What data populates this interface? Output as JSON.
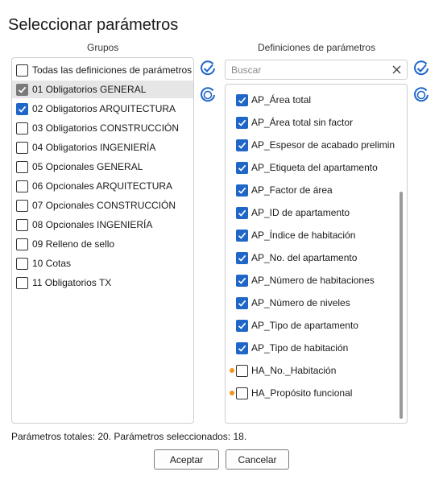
{
  "dialog": {
    "title": "Seleccionar parámetros",
    "groups_header": "Grupos",
    "definitions_header": "Definiciones de parámetros",
    "search_placeholder": "Buscar",
    "status": "Parámetros totales: 20. Parámetros seleccionados: 18.",
    "accept_label": "Aceptar",
    "cancel_label": "Cancelar",
    "accent_color": "#1e66c8",
    "highlight_dot_color": "#f0961e"
  },
  "groups": [
    {
      "label": "Todas las definiciones de parámetros",
      "state": "unchecked",
      "selected": false
    },
    {
      "label": "01 Obligatorios GENERAL",
      "state": "checked-gray",
      "selected": true
    },
    {
      "label": "02 Obligatorios ARQUITECTURA",
      "state": "checked",
      "selected": false
    },
    {
      "label": "03 Obligatorios CONSTRUCCIÓN",
      "state": "unchecked",
      "selected": false
    },
    {
      "label": "04 Obligatorios INGENIERÍA",
      "state": "unchecked",
      "selected": false
    },
    {
      "label": "05 Opcionales GENERAL",
      "state": "unchecked",
      "selected": false
    },
    {
      "label": "06 Opcionales ARQUITECTURA",
      "state": "unchecked",
      "selected": false
    },
    {
      "label": "07 Opcionales CONSTRUCCIÓN",
      "state": "unchecked",
      "selected": false
    },
    {
      "label": "08 Opcionales INGENIERÍA",
      "state": "unchecked",
      "selected": false
    },
    {
      "label": "09 Relleno de sello",
      "state": "unchecked",
      "selected": false
    },
    {
      "label": "10 Cotas",
      "state": "unchecked",
      "selected": false
    },
    {
      "label": "11 Obligatorios TX",
      "state": "unchecked",
      "selected": false
    }
  ],
  "definitions": [
    {
      "label": "AP_Área total",
      "checked": true,
      "dot": false
    },
    {
      "label": "AP_Área total sin factor",
      "checked": true,
      "dot": false
    },
    {
      "label": "AP_Espesor de acabado prelimin",
      "checked": true,
      "dot": false
    },
    {
      "label": "AP_Etiqueta del apartamento",
      "checked": true,
      "dot": false
    },
    {
      "label": "AP_Factor de área",
      "checked": true,
      "dot": false
    },
    {
      "label": "AP_ID de apartamento",
      "checked": true,
      "dot": false
    },
    {
      "label": "AP_Índice de habitación",
      "checked": true,
      "dot": false
    },
    {
      "label": "AP_No. del apartamento",
      "checked": true,
      "dot": false
    },
    {
      "label": "AP_Número de habitaciones",
      "checked": true,
      "dot": false
    },
    {
      "label": "AP_Número de niveles",
      "checked": true,
      "dot": false
    },
    {
      "label": "AP_Tipo de apartamento",
      "checked": true,
      "dot": false
    },
    {
      "label": "AP_Tipo de habitación",
      "checked": true,
      "dot": false
    },
    {
      "label": "HA_No._Habitación",
      "checked": false,
      "dot": true
    },
    {
      "label": "HA_Propósito funcional",
      "checked": false,
      "dot": true
    }
  ]
}
